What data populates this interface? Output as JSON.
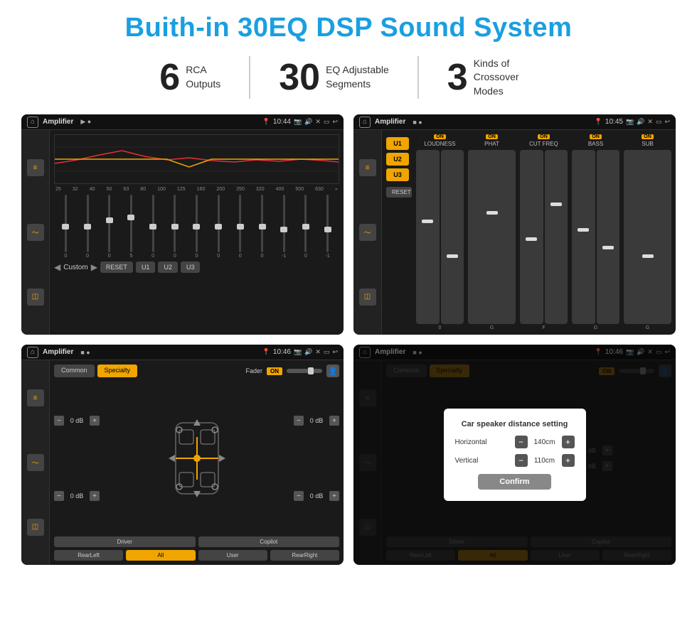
{
  "page": {
    "title": "Buith-in 30EQ DSP Sound System",
    "bg_color": "#ffffff"
  },
  "stats": [
    {
      "number": "6",
      "label_line1": "RCA",
      "label_line2": "Outputs"
    },
    {
      "number": "30",
      "label_line1": "EQ Adjustable",
      "label_line2": "Segments"
    },
    {
      "number": "3",
      "label_line1": "Kinds of",
      "label_line2": "Crossover Modes"
    }
  ],
  "screens": {
    "screen1": {
      "title": "Amplifier",
      "time": "10:44",
      "freq_labels": [
        "25",
        "32",
        "40",
        "50",
        "63",
        "80",
        "100",
        "125",
        "160",
        "200",
        "250",
        "320",
        "400",
        "500",
        "630"
      ],
      "slider_values": [
        "0",
        "0",
        "0",
        "5",
        "0",
        "0",
        "0",
        "0",
        "0",
        "0",
        "-1",
        "0",
        "-1"
      ],
      "buttons": [
        "Custom",
        "RESET",
        "U1",
        "U2",
        "U3"
      ]
    },
    "screen2": {
      "title": "Amplifier",
      "time": "10:45",
      "presets": [
        "U1",
        "U2",
        "U3"
      ],
      "channels": [
        {
          "name": "LOUDNESS",
          "on": true
        },
        {
          "name": "PHAT",
          "on": true
        },
        {
          "name": "CUT FREQ",
          "on": true
        },
        {
          "name": "BASS",
          "on": true
        },
        {
          "name": "SUB",
          "on": true
        }
      ],
      "reset_label": "RESET"
    },
    "screen3": {
      "title": "Amplifier",
      "time": "10:46",
      "tabs": [
        "Common",
        "Specialty"
      ],
      "active_tab": "Specialty",
      "fader_label": "Fader",
      "fader_on": "ON",
      "bottom_buttons": [
        "Driver",
        "",
        "Copilot",
        "RearLeft",
        "All",
        "",
        "User",
        "RearRight"
      ],
      "db_values": [
        "0 dB",
        "0 dB",
        "0 dB",
        "0 dB"
      ]
    },
    "screen4": {
      "title": "Amplifier",
      "time": "10:46",
      "tabs": [
        "Common",
        "Specialty"
      ],
      "dialog": {
        "title": "Car speaker distance setting",
        "horizontal_label": "Horizontal",
        "horizontal_value": "140cm",
        "vertical_label": "Vertical",
        "vertical_value": "110cm",
        "confirm_label": "Confirm"
      },
      "bottom_buttons": [
        "Driver",
        "Copilot",
        "RearLeft",
        "User",
        "RearRight"
      ],
      "db_values": [
        "0 dB",
        "0 dB"
      ]
    }
  }
}
